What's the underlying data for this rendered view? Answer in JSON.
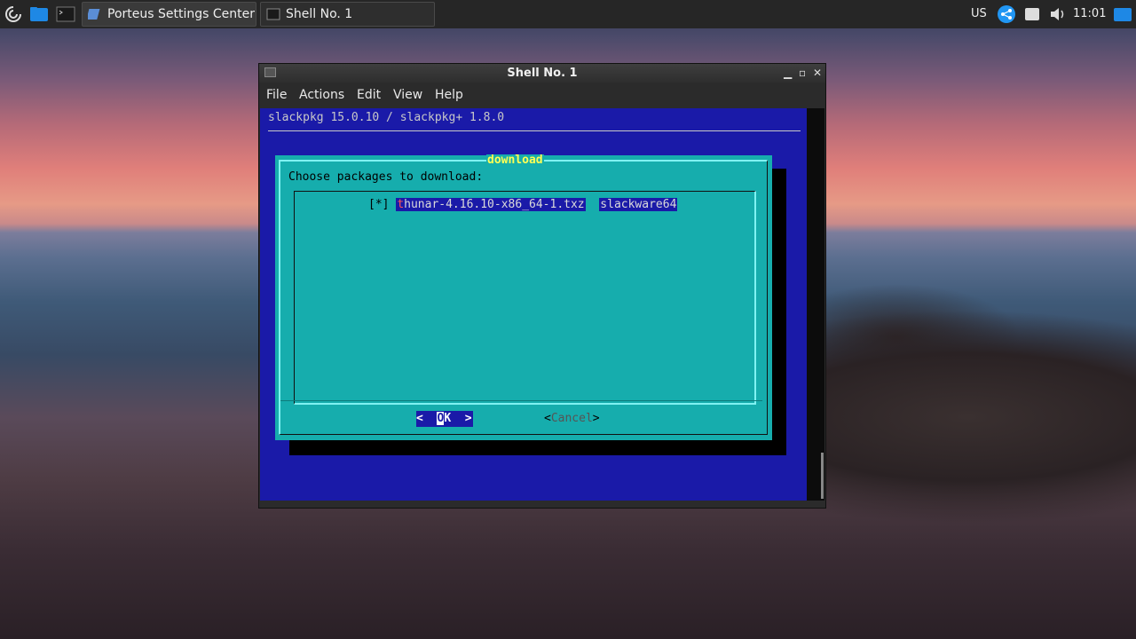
{
  "taskbar": {
    "tasks": [
      {
        "label": "Porteus Settings Center"
      },
      {
        "label": "Shell No. 1"
      }
    ],
    "tray": {
      "keyboard_layout": "US",
      "clock": "11:01"
    }
  },
  "window": {
    "title": "Shell No. 1",
    "menu": [
      "File",
      "Actions",
      "Edit",
      "View",
      "Help"
    ]
  },
  "terminal": {
    "header": "slackpkg 15.0.10 / slackpkg+ 1.8.0",
    "dialog": {
      "title": "download",
      "prompt": "Choose packages to download:",
      "items": [
        {
          "checkbox": "[*]",
          "package": "thunar-4.16.10-x86_64-1.txz",
          "repository": "slackware64"
        }
      ],
      "ok_hotkey": "O",
      "ok_rest": "K",
      "cancel_label": "Cancel"
    }
  },
  "colors": {
    "terminal_bg": "#1a1aa8",
    "dialog_bg": "#16adad",
    "dialog_title": "#ffff55",
    "taskbar_bg": "#262626"
  }
}
